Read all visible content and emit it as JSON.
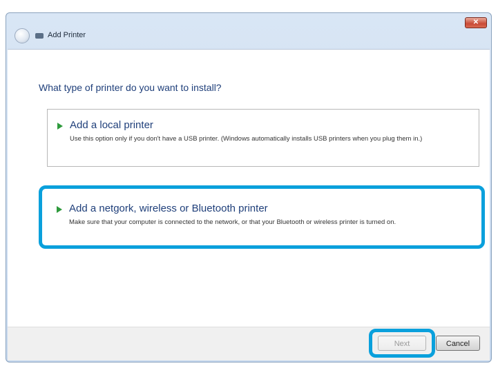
{
  "window": {
    "title": "Add Printer",
    "close_label": "✕"
  },
  "main": {
    "heading": "What type of printer do you want to install?",
    "options": [
      {
        "title": "Add a local printer",
        "description": "Use this option only if you don't have a USB printer. (Windows automatically installs USB printers when you plug them in.)"
      },
      {
        "title": "Add a netgork, wireless or Bluetooth printer",
        "description": "Make sure that your computer is connected to the network, or that your Bluetooth or wireless printer is turned on."
      }
    ]
  },
  "footer": {
    "next_label": "Next",
    "cancel_label": "Cancel"
  },
  "colors": {
    "highlight": "#0aa0dc",
    "heading": "#1f3f7a",
    "arrow": "#2e9a3c"
  },
  "icons": {
    "back": "back-arrow-icon",
    "title": "printer-icon",
    "option": "green-arrow-icon",
    "close": "close-icon"
  }
}
